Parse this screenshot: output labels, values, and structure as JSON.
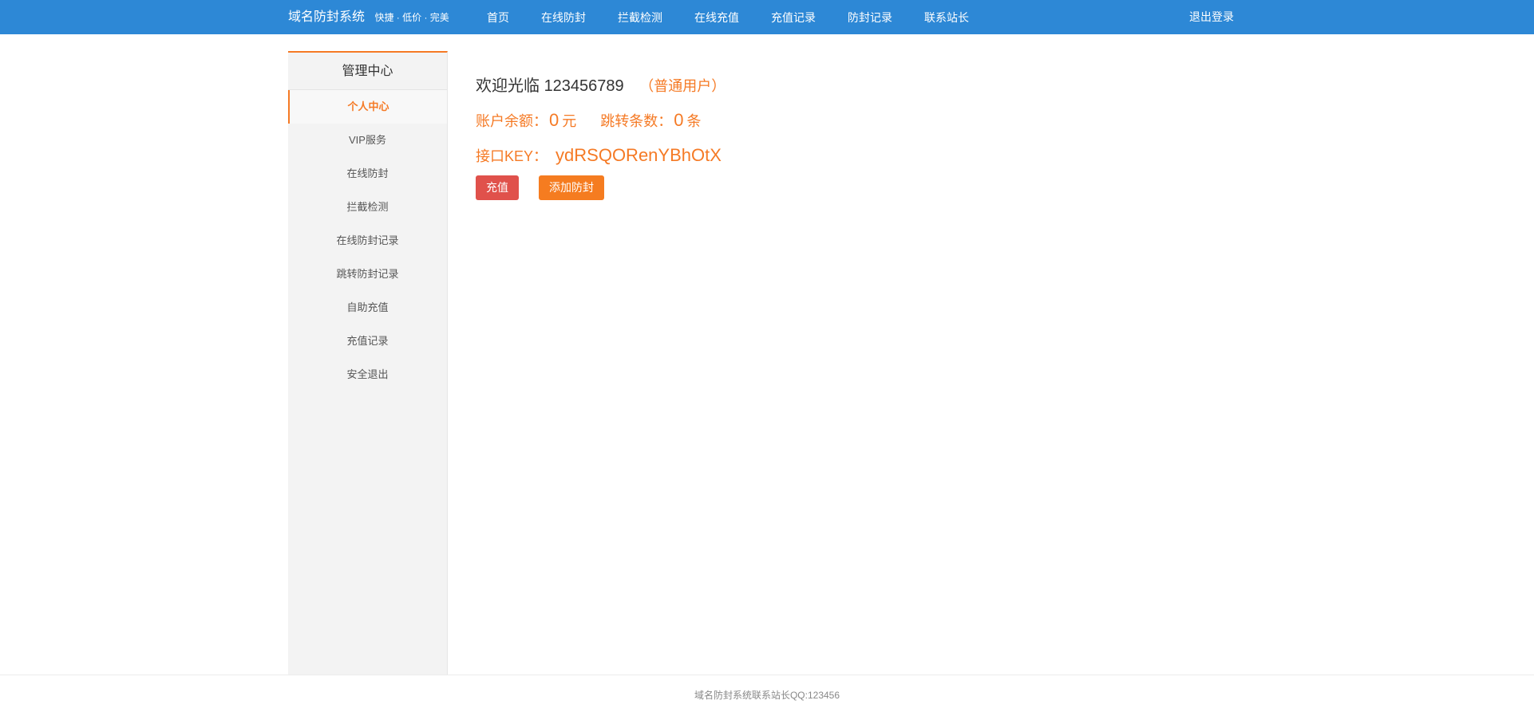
{
  "header": {
    "brand_title": "域名防封系统",
    "brand_slogan": "快捷 · 低价 · 完美",
    "nav": [
      {
        "label": "首页"
      },
      {
        "label": "在线防封"
      },
      {
        "label": "拦截检测"
      },
      {
        "label": "在线充值"
      },
      {
        "label": "充值记录"
      },
      {
        "label": "防封记录"
      },
      {
        "label": "联系站长"
      }
    ],
    "logout_label": "退出登录",
    "bar_color": "#2d88d6"
  },
  "sidebar": {
    "title": "管理中心",
    "active_index": 0,
    "items": [
      {
        "label": "个人中心"
      },
      {
        "label": "VIP服务"
      },
      {
        "label": "在线防封"
      },
      {
        "label": "拦截检测"
      },
      {
        "label": "在线防封记录"
      },
      {
        "label": "跳转防封记录"
      },
      {
        "label": "自助充值"
      },
      {
        "label": "充值记录"
      },
      {
        "label": "安全退出"
      }
    ],
    "accent_color": "#f57a25"
  },
  "main": {
    "welcome_prefix": "欢迎光临",
    "username": "123456789",
    "role": "（普通用户）",
    "balance_label": "账户余额：",
    "balance_value": "0",
    "balance_unit": "元",
    "jump_label": "跳转条数：",
    "jump_value": "0",
    "jump_unit": "条",
    "key_label": "接口KEY：",
    "key_value": "ydRSQORenYBhOtX",
    "recharge_button": "充值",
    "add_button": "添加防封",
    "recharge_color": "#e0514b",
    "add_color": "#f57c20"
  },
  "footer": {
    "text": "域名防封系统联系站长QQ:123456"
  }
}
